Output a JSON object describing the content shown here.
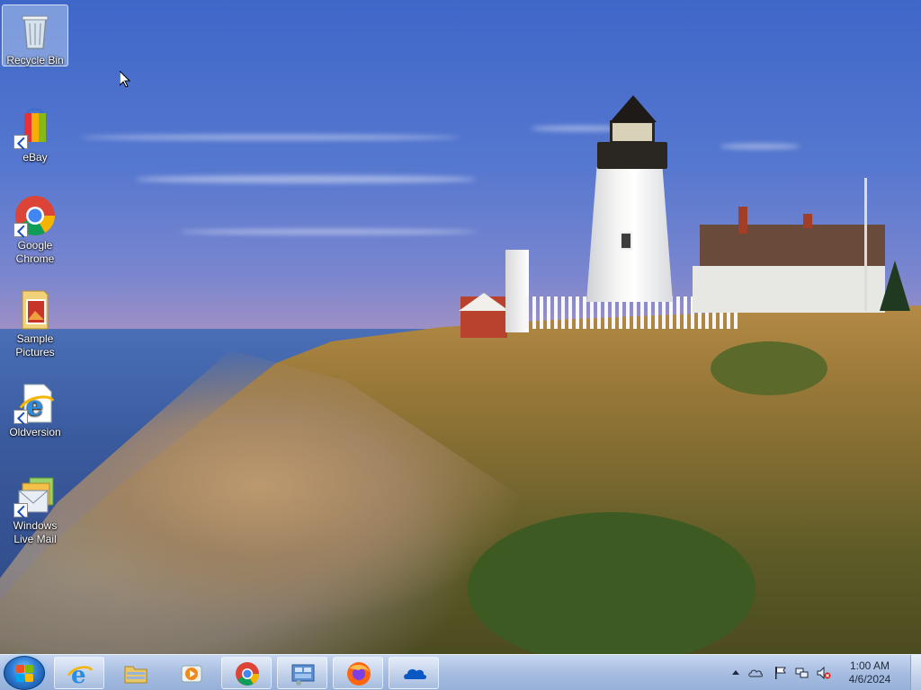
{
  "desktop": {
    "icons": [
      {
        "id": "recycle-bin",
        "label": "Recycle Bin",
        "selected": true
      },
      {
        "id": "ebay",
        "label": "eBay",
        "shortcut": true
      },
      {
        "id": "google-chrome",
        "label": "Google Chrome",
        "shortcut": true
      },
      {
        "id": "sample-pictures",
        "label": "Sample Pictures"
      },
      {
        "id": "oldversion",
        "label": "Oldversion",
        "shortcut": true
      },
      {
        "id": "windows-live-mail",
        "label": "Windows Live Mail",
        "shortcut": true
      }
    ]
  },
  "taskbar": {
    "start": {
      "icon": "windows-start-orb"
    },
    "pinned": [
      {
        "id": "internet-explorer",
        "icon": "internet-explorer-icon"
      },
      {
        "id": "file-explorer",
        "icon": "folder-icon"
      },
      {
        "id": "media-player",
        "icon": "media-player-icon"
      },
      {
        "id": "chrome",
        "icon": "chrome-icon"
      },
      {
        "id": "control-panel",
        "icon": "control-panel-icon"
      },
      {
        "id": "firefox",
        "icon": "firefox-icon"
      },
      {
        "id": "onedrive",
        "icon": "cloud-icon"
      }
    ],
    "tray": {
      "icons": [
        "show-hidden-icons-arrow",
        "onedrive-tray-icon",
        "action-center-flag-icon",
        "network-icon",
        "volume-muted-icon"
      ],
      "time": "1:00 AM",
      "date": "4/6/2024"
    }
  },
  "colors": {
    "taskbar": "#b4c8e6",
    "start_orb": "#2e7fd6",
    "icon_label": "#ffffff"
  }
}
